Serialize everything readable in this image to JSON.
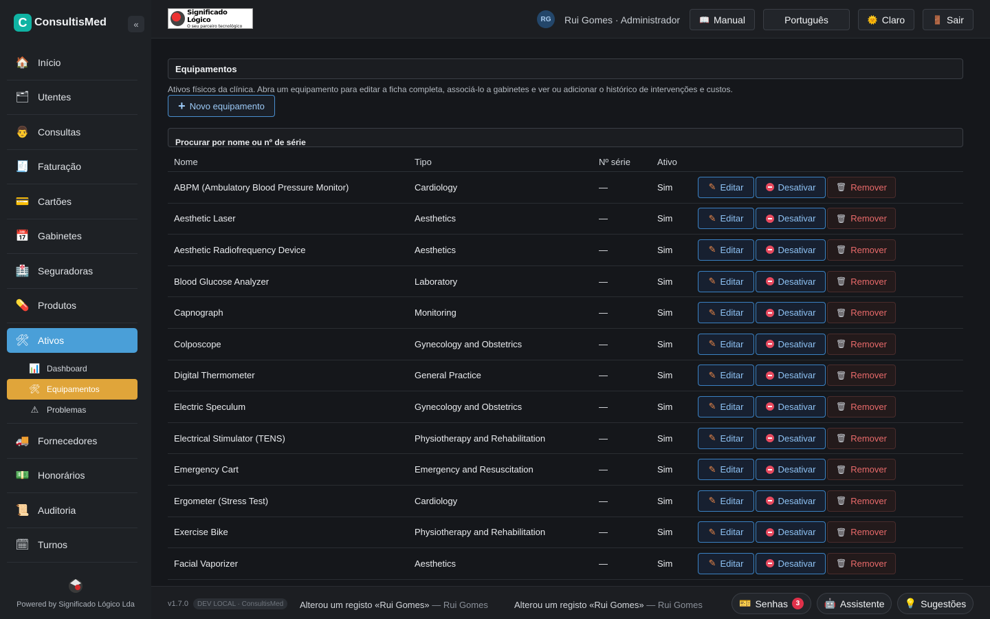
{
  "app": {
    "name": "ConsultisMed",
    "logo_letter": "C",
    "collapse": "«"
  },
  "partner_logo": {
    "line1": "Significado Lógico",
    "line2": "O seu parceiro tecnológico"
  },
  "user": {
    "initials": "RG",
    "label": "Rui Gomes · Administrador"
  },
  "topbar": {
    "manual": {
      "icon": "book-icon",
      "label": "Manual"
    },
    "language": {
      "label": "Português"
    },
    "theme": {
      "icon": "sun-icon",
      "label": "Claro"
    },
    "logout": {
      "icon": "door-icon",
      "label": "Sair"
    }
  },
  "sidebar": {
    "items": [
      {
        "key": "inicio",
        "label": "Início",
        "icon": "🏠"
      },
      {
        "key": "utentes",
        "label": "Utentes",
        "icon": "🗂"
      },
      {
        "key": "consultas",
        "label": "Consultas",
        "icon": "👨"
      },
      {
        "key": "faturacao",
        "label": "Faturação",
        "icon": "🧾"
      },
      {
        "key": "cartoes",
        "label": "Cartões",
        "icon": "💳"
      },
      {
        "key": "gabinetes",
        "label": "Gabinetes",
        "icon": "📅"
      },
      {
        "key": "seguradoras",
        "label": "Seguradoras",
        "icon": "🏥"
      },
      {
        "key": "produtos",
        "label": "Produtos",
        "icon": "💊"
      },
      {
        "key": "ativos",
        "label": "Ativos",
        "icon": "🛠"
      }
    ],
    "sub_items": [
      {
        "label": "Dashboard",
        "icon": "📊"
      },
      {
        "label": "Equipamentos",
        "icon": "🛠"
      },
      {
        "label": "Problemas",
        "icon": "⚠"
      }
    ],
    "items_after": [
      {
        "key": "fornecedores",
        "label": "Fornecedores",
        "icon": "🚚"
      },
      {
        "key": "honorarios",
        "label": "Honorários",
        "icon": "💵"
      },
      {
        "key": "auditoria",
        "label": "Auditoria",
        "icon": "📜"
      },
      {
        "key": "turnos",
        "label": "Turnos",
        "icon": "🗓"
      }
    ],
    "powered_by": "Powered by Significado Lógico Lda"
  },
  "main": {
    "title": "Equipamentos",
    "description": "Ativos físicos da clínica. Abra um equipamento para editar a ficha completa, associá-lo a gabinetes e ver ou adicionar o histórico de intervenções e custos.",
    "new_button": "Novo equipamento",
    "search_placeholder": "Procurar por nome ou nº de série"
  },
  "table": {
    "headers": {
      "name": "Nome",
      "type": "Tipo",
      "serial": "Nº série",
      "active": "Ativo"
    },
    "actions": {
      "edit": "Editar",
      "deactivate": "Desativar",
      "remove": "Remover"
    },
    "rows": [
      {
        "name": "ABPM (Ambulatory Blood Pressure Monitor)",
        "type": "Cardiology",
        "serial": "—",
        "active": "Sim"
      },
      {
        "name": "Aesthetic Laser",
        "type": "Aesthetics",
        "serial": "—",
        "active": "Sim"
      },
      {
        "name": "Aesthetic Radiofrequency Device",
        "type": "Aesthetics",
        "serial": "—",
        "active": "Sim"
      },
      {
        "name": "Blood Glucose Analyzer",
        "type": "Laboratory",
        "serial": "—",
        "active": "Sim"
      },
      {
        "name": "Capnograph",
        "type": "Monitoring",
        "serial": "—",
        "active": "Sim"
      },
      {
        "name": "Colposcope",
        "type": "Gynecology and Obstetrics",
        "serial": "—",
        "active": "Sim"
      },
      {
        "name": "Digital Thermometer",
        "type": "General Practice",
        "serial": "—",
        "active": "Sim"
      },
      {
        "name": "Electric Speculum",
        "type": "Gynecology and Obstetrics",
        "serial": "—",
        "active": "Sim"
      },
      {
        "name": "Electrical Stimulator (TENS)",
        "type": "Physiotherapy and Rehabilitation",
        "serial": "—",
        "active": "Sim"
      },
      {
        "name": "Emergency Cart",
        "type": "Emergency and Resuscitation",
        "serial": "—",
        "active": "Sim"
      },
      {
        "name": "Ergometer (Stress Test)",
        "type": "Cardiology",
        "serial": "—",
        "active": "Sim"
      },
      {
        "name": "Exercise Bike",
        "type": "Physiotherapy and Rehabilitation",
        "serial": "—",
        "active": "Sim"
      },
      {
        "name": "Facial Vaporizer",
        "type": "Aesthetics",
        "serial": "—",
        "active": "Sim"
      }
    ]
  },
  "footer": {
    "version": "v1.7.0",
    "env": "DEV LOCAL · ConsultisMed",
    "logs": [
      {
        "text": "Alterou um registo «Rui Gomes»",
        "user": "— Rui Gomes"
      },
      {
        "text": "Alterou um registo «Rui Gomes»",
        "user": "— Rui Gomes"
      }
    ],
    "senhas": {
      "label": "Senhas",
      "count": "3"
    },
    "assistente": {
      "label": "Assistente"
    },
    "sugestoes": {
      "label": "Sugestões"
    }
  },
  "colors": {
    "accent": "#4a9fd8",
    "sub_active": "#e0a53a",
    "danger": "#e86a6a"
  }
}
